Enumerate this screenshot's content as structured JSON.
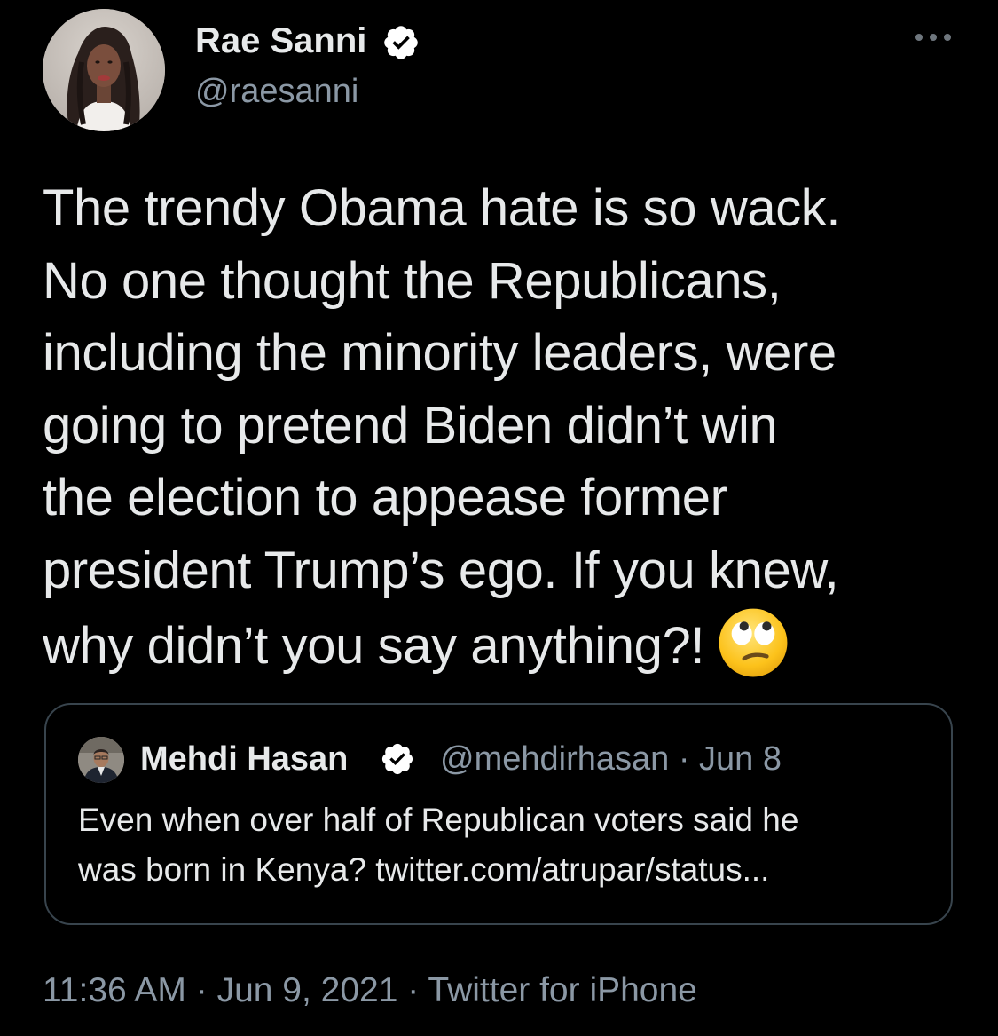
{
  "author": {
    "display_name": "Rae Sanni",
    "handle": "@raesanni",
    "verified": true
  },
  "tweet": {
    "lines": [
      "The trendy Obama hate is so wack.",
      "No one thought the Republicans,",
      "including the minority leaders, were",
      "going to pretend Biden didn’t win",
      "the election to appease former",
      "president Trump’s ego. If you knew,",
      "why didn’t you say anything?!"
    ],
    "emoji": "face-with-rolling-eyes"
  },
  "quoted_tweet": {
    "display_name": "Mehdi Hasan",
    "handle": "@mehdirhasan",
    "separator": "·",
    "date": "Jun 8",
    "verified": true,
    "lines": [
      "Even when over half of Republican voters said he",
      "was born in Kenya? twitter.com/atrupar/status..."
    ]
  },
  "footer": {
    "time": "11:36 AM",
    "separator": "·",
    "date": "Jun 9, 2021",
    "source": "Twitter for iPhone"
  },
  "colors": {
    "background": "#000000",
    "primary_text": "#e7e9ea",
    "secondary_text": "#8b98a5",
    "card_border": "#38444d",
    "verified_badge": "#ffffff"
  }
}
